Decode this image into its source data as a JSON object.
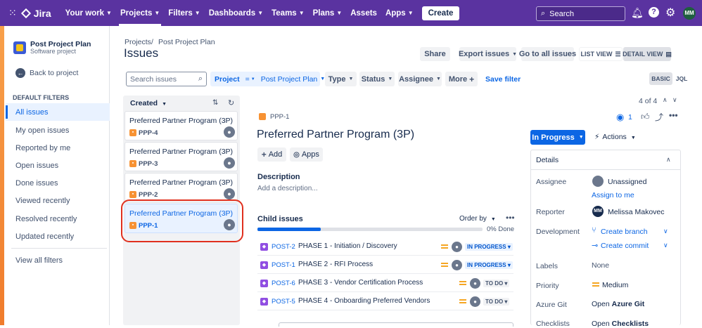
{
  "topnav": {
    "logo": "Jira",
    "items": [
      "Your work",
      "Projects",
      "Filters",
      "Dashboards",
      "Teams",
      "Plans",
      "Assets",
      "Apps"
    ],
    "create_label": "Create",
    "search_placeholder": "Search",
    "avatar_initials": "MM"
  },
  "sidebar": {
    "project_name": "Post Project Plan",
    "project_type": "Software project",
    "back_label": "Back to project",
    "section_title": "DEFAULT FILTERS",
    "filters": [
      "All issues",
      "My open issues",
      "Reported by me",
      "Open issues",
      "Done issues",
      "Viewed recently",
      "Resolved recently",
      "Updated recently"
    ],
    "view_all": "View all filters"
  },
  "header": {
    "breadcrumb_root": "Projects",
    "breadcrumb_sep": "/",
    "breadcrumb_project": "Post Project Plan",
    "title": "Issues",
    "share": "Share",
    "export": "Export issues",
    "goto_all": "Go to all issues",
    "list_view": "LIST VIEW",
    "detail_view": "DETAIL VIEW"
  },
  "filterbar": {
    "search_placeholder": "Search issues",
    "project_label": "Project",
    "project_op": "=",
    "project_value": "Post Project Plan",
    "type": "Type",
    "status": "Status",
    "assignee": "Assignee",
    "more": "More",
    "save_filter": "Save filter",
    "basic": "BASIC",
    "jql": "JQL"
  },
  "list": {
    "sort_label": "Created",
    "cards": [
      {
        "title": "Preferred Partner Program (3P)",
        "key": "PPP-4"
      },
      {
        "title": "Preferred Partner Program (3P)",
        "key": "PPP-3"
      },
      {
        "title": "Preferred Partner Program (3P)",
        "key": "PPP-2"
      },
      {
        "title": "Preferred Partner Program (3P)",
        "key": "PPP-1"
      }
    ],
    "selected_index": 3
  },
  "issue": {
    "key": "PPP-1",
    "title": "Preferred Partner Program (3P)",
    "add_label": "Add",
    "apps_label": "Apps",
    "description_heading": "Description",
    "description_placeholder": "Add a description...",
    "child_heading": "Child issues",
    "order_by": "Order by",
    "progress_text": "0% Done",
    "progress_fraction": 0.28,
    "children": [
      {
        "key": "POST-2",
        "summary": "PHASE 1 - Initiation / Discovery",
        "status": "IN PROGRESS"
      },
      {
        "key": "POST-1",
        "summary": "PHASE 2 - RFI Process",
        "status": "IN PROGRESS"
      },
      {
        "key": "POST-6",
        "summary": "PHASE 3 - Vendor Certification Process",
        "status": "TO DO"
      },
      {
        "key": "POST-5",
        "summary": "PHASE 4 - Onboarding Preferred Vendors",
        "status": "TO DO"
      }
    ]
  },
  "details": {
    "counter": "4 of 4",
    "watchers": "1",
    "status_button": "In Progress",
    "actions": "Actions",
    "panel_title": "Details",
    "assignee_label": "Assignee",
    "assignee_value": "Unassigned",
    "assign_to_me": "Assign to me",
    "reporter_label": "Reporter",
    "reporter_value": "Melissa Makovec",
    "reporter_initials": "MM",
    "development_label": "Development",
    "create_branch": "Create branch",
    "create_commit": "Create commit",
    "labels_label": "Labels",
    "labels_value": "None",
    "priority_label": "Priority",
    "priority_value": "Medium",
    "azure_label": "Azure Git",
    "azure_prefix": "Open",
    "azure_value": "Azure Git",
    "checklists_label": "Checklists",
    "checklists_prefix": "Open",
    "checklists_value": "Checklists"
  },
  "colors": {
    "nav_purple": "#5a33a0",
    "link_blue": "#0c66e4",
    "highlight_red": "#e0301e",
    "status_blue": "#0c66e4"
  }
}
